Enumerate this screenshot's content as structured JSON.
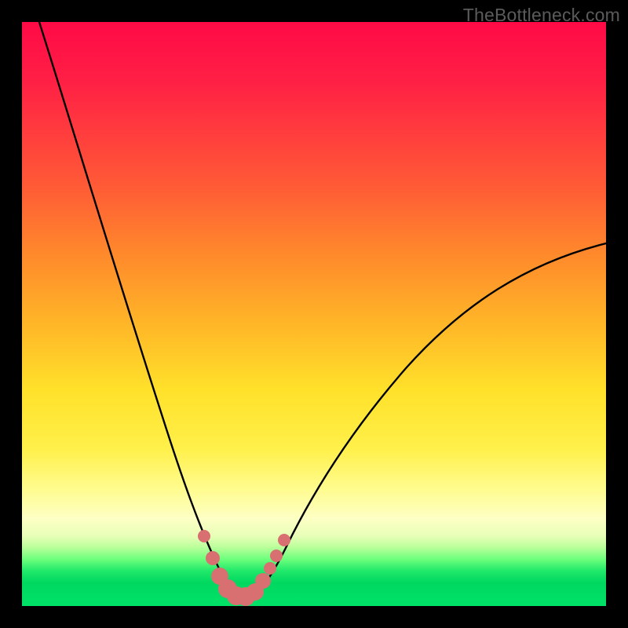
{
  "watermark": {
    "text": "TheBottleneck.com"
  },
  "chart_data": {
    "type": "line",
    "title": "",
    "xlabel": "",
    "ylabel": "",
    "xlim": [
      0,
      100
    ],
    "ylim": [
      0,
      100
    ],
    "grid": false,
    "series": [
      {
        "name": "bottleneck-curve",
        "x": [
          3,
          8,
          13,
          18,
          22,
          26,
          29,
          31,
          33,
          35,
          37,
          39,
          42,
          46,
          52,
          60,
          70,
          82,
          95,
          100
        ],
        "y": [
          100,
          85,
          70,
          55,
          42,
          30,
          20,
          12,
          6,
          2,
          1,
          2,
          5,
          10,
          18,
          28,
          38,
          47,
          55,
          58
        ]
      }
    ],
    "markers": {
      "name": "salmon-dots",
      "color": "#d87072",
      "points_x": [
        29,
        30.5,
        32,
        33.5,
        35,
        36.5,
        38,
        39.5,
        41,
        42,
        43.5
      ],
      "points_y": [
        11,
        7,
        4,
        2,
        1.3,
        1.3,
        2.2,
        4,
        6,
        8,
        11
      ],
      "radius": [
        6,
        7,
        9,
        10,
        10,
        10,
        10,
        8,
        7,
        6,
        6
      ]
    },
    "background_gradient": {
      "stops": [
        {
          "pos": 0.0,
          "color": "#ff0a46"
        },
        {
          "pos": 0.4,
          "color": "#ff8a2b"
        },
        {
          "pos": 0.63,
          "color": "#ffe12a"
        },
        {
          "pos": 0.85,
          "color": "#fdffc4"
        },
        {
          "pos": 0.94,
          "color": "#20e86a"
        },
        {
          "pos": 1.0,
          "color": "#00e268"
        }
      ]
    }
  }
}
